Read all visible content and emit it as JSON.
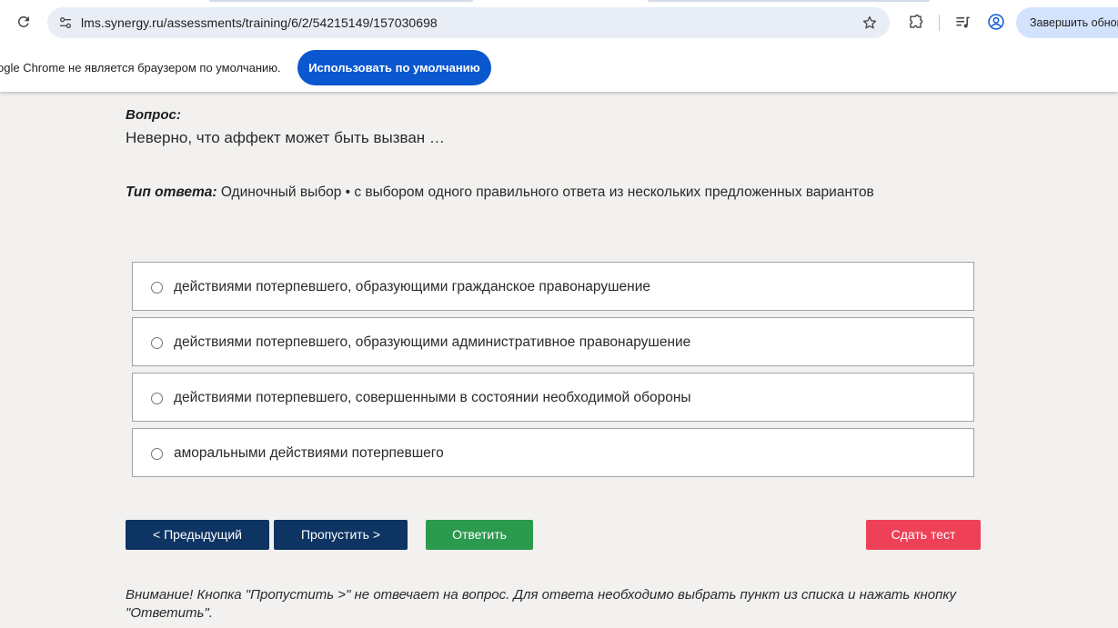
{
  "browser": {
    "url": "lms.synergy.ru/assessments/training/6/2/54215149/157030698",
    "finish_update_label": "Завершить обнов"
  },
  "infobar": {
    "message": "ogle Chrome не является браузером по умолчанию.",
    "button_label": "Использовать по умолчанию"
  },
  "question": {
    "label": "Вопрос:",
    "text": "Неверно, что аффект может быть вызван …",
    "answer_type_label": "Тип ответа:",
    "answer_type_value": "Одиночный выбор • с выбором одного правильного ответа из нескольких предложенных вариантов"
  },
  "options": [
    {
      "text": "действиями потерпевшего, образующими гражданское правонарушение"
    },
    {
      "text": "действиями потерпевшего, образующими административное правонарушение"
    },
    {
      "text": "действиями потерпевшего, совершенными в состоянии необходимой обороны"
    },
    {
      "text": "аморальными действиями потерпевшего"
    }
  ],
  "buttons": {
    "prev": "< Предыдущий",
    "skip": "Пропустить >",
    "answer": "Ответить",
    "submit": "Сдать тест"
  },
  "notice": "Внимание! Кнопка \"Пропустить >\" не отвечает на вопрос. Для ответа необходимо выбрать пункт из списка и нажать кнопку \"Ответить\".",
  "colors": {
    "primary_dark_blue": "#0e3463",
    "answer_green": "#2b9a4e",
    "submit_red": "#ee4157",
    "chrome_blue": "#0b57d0",
    "page_background": "#f2f1ef"
  },
  "icons": [
    "reload-icon",
    "site-info-icon",
    "bookmark-star-icon",
    "extensions-icon",
    "media-controls-icon",
    "profile-icon"
  ]
}
